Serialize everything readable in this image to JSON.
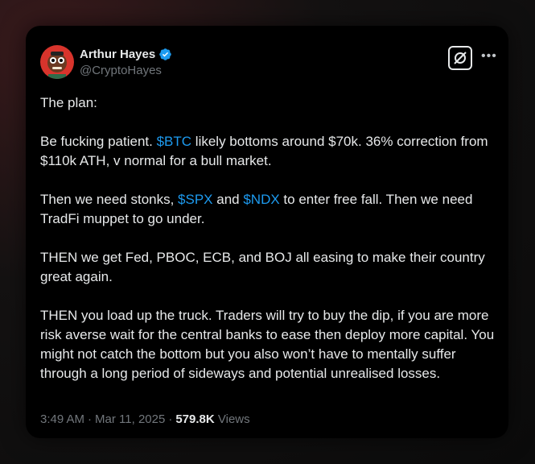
{
  "author": {
    "name": "Arthur Hayes",
    "handle": "@CryptoHayes",
    "verified": true,
    "accent_color": "#1d9bf0"
  },
  "tweet": {
    "p1": "The plan:",
    "p2": {
      "a": "Be fucking patient. ",
      "cashtag1": "$BTC",
      "b": " likely bottoms around $70k. 36% correction from $110k ATH, v normal for a bull market."
    },
    "p3": {
      "a": "Then we need stonks, ",
      "cashtag1": "$SPX",
      "b": " and ",
      "cashtag2": "$NDX",
      "c": " to enter free fall. Then we need TradFi muppet to go under."
    },
    "p4": "THEN we get Fed, PBOC, ECB, and BOJ all easing to make their country great again.",
    "p5": "THEN you load up the truck. Traders will try to buy the dip, if you are more risk averse wait for the central banks to ease then deploy more capital. You might not catch the bottom but you also won’t have to mentally suffer through a long period of sideways and potential unrealised losses."
  },
  "meta": {
    "time": "3:49 AM",
    "dot1": "·",
    "date": "Mar 11, 2025",
    "dot2": "·",
    "views_count": "579.8K",
    "views_label": "Views"
  },
  "icons": {
    "verified": "verified-badge-icon",
    "grok": "grok-icon",
    "more": "more-icon"
  }
}
